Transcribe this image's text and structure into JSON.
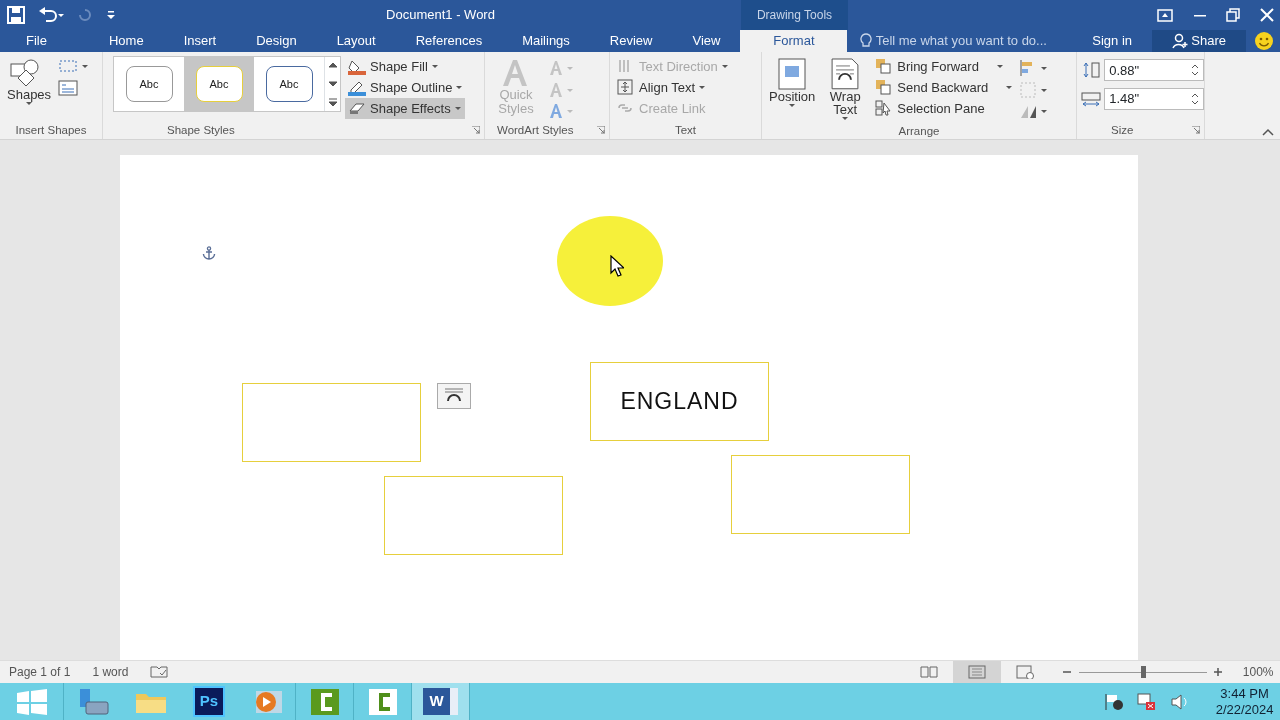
{
  "window": {
    "title": "Document1 - Word",
    "context_group": "Drawing Tools"
  },
  "tabs": [
    {
      "label": "File",
      "selected": false
    },
    {
      "label": "Home",
      "selected": false
    },
    {
      "label": "Insert",
      "selected": false
    },
    {
      "label": "Design",
      "selected": false
    },
    {
      "label": "Layout",
      "selected": false
    },
    {
      "label": "References",
      "selected": false
    },
    {
      "label": "Mailings",
      "selected": false
    },
    {
      "label": "Review",
      "selected": false
    },
    {
      "label": "View",
      "selected": false
    },
    {
      "label": "Format",
      "selected": true
    }
  ],
  "tell_me": {
    "placeholder": "Tell me what you want to do..."
  },
  "account": {
    "sign_in": "Sign in",
    "share": "Share"
  },
  "ribbon": [
    {
      "label": "Insert Shapes",
      "kind": "shapes",
      "large": {
        "label": "Shapes"
      }
    },
    {
      "label": "Shape Styles",
      "kind": "styles",
      "gallery": [
        {
          "label": "Abc",
          "selected": false
        },
        {
          "label": "Abc",
          "selected": true
        },
        {
          "label": "Abc",
          "selected": false
        }
      ],
      "commands": [
        {
          "label": "Shape Fill",
          "highlighted": false
        },
        {
          "label": "Shape Outline",
          "highlighted": false
        },
        {
          "label": "Shape Effects",
          "highlighted": true
        }
      ]
    },
    {
      "label": "WordArt Styles",
      "kind": "wordart",
      "large": {
        "label": "Quick Styles",
        "disabled": true
      }
    },
    {
      "label": "Text",
      "kind": "text",
      "commands": [
        {
          "label": "Text Direction",
          "disabled": true
        },
        {
          "label": "Align Text",
          "disabled": false
        },
        {
          "label": "Create Link",
          "disabled": true
        }
      ]
    },
    {
      "label": "Arrange",
      "kind": "arrange",
      "large": [
        {
          "label": "Position"
        },
        {
          "label": "Wrap Text"
        }
      ],
      "commands": [
        {
          "label": "Bring Forward"
        },
        {
          "label": "Send Backward"
        },
        {
          "label": "Selection Pane"
        }
      ]
    },
    {
      "label": "Size",
      "kind": "size",
      "fields": [
        {
          "value": "0.88\""
        },
        {
          "value": "1.48\""
        }
      ]
    }
  ],
  "document": {
    "shapes": [
      {
        "kind": "text_box",
        "text": "ENGLAND"
      },
      {
        "kind": "text_box"
      },
      {
        "kind": "text_box"
      },
      {
        "kind": "text_box"
      }
    ]
  },
  "status_bar": {
    "page": "Page 1 of 1",
    "words": "1 word",
    "views": [
      {
        "selected": false
      },
      {
        "selected": true
      },
      {
        "selected": false
      }
    ],
    "zoom": {
      "level": 0.5,
      "reading": "100%"
    }
  },
  "taskbar": {
    "apps": [
      {
        "kind": "server",
        "selected": false
      },
      {
        "kind": "folder",
        "selected": false
      },
      {
        "kind": "ps",
        "label": "Ps",
        "selected": false
      },
      {
        "kind": "player",
        "selected": false
      },
      {
        "kind": "camtasia",
        "selected": false
      },
      {
        "kind": "camtasia2",
        "selected": false
      },
      {
        "kind": "word",
        "label": "W",
        "selected": true
      }
    ],
    "time": "3:44 PM",
    "date": "2/22/2024"
  }
}
